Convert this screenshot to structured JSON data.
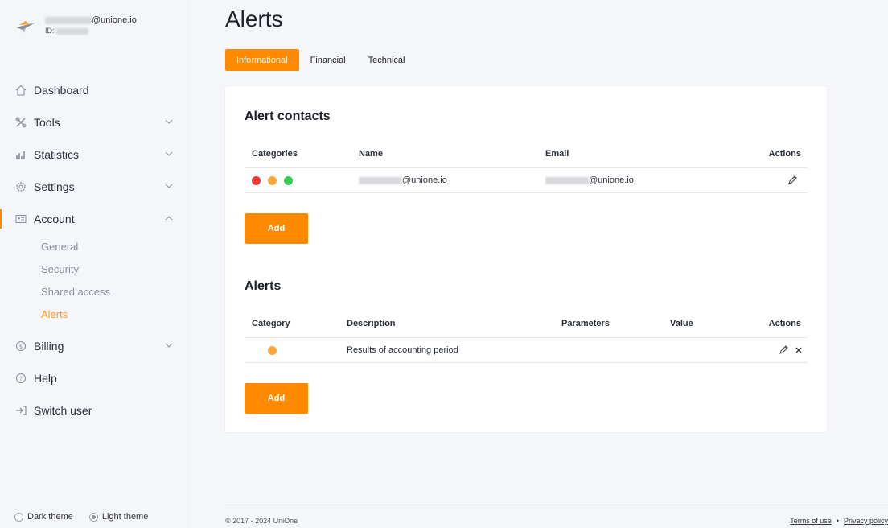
{
  "user": {
    "email_suffix": "@unione.io",
    "id_label": "ID:"
  },
  "nav": {
    "dashboard": "Dashboard",
    "tools": "Tools",
    "statistics": "Statistics",
    "settings": "Settings",
    "account": "Account",
    "account_sub": [
      "General",
      "Security",
      "Shared access",
      "Alerts"
    ],
    "billing": "Billing",
    "help": "Help",
    "switch_user": "Switch user"
  },
  "theme": {
    "dark": "Dark theme",
    "light": "Light theme",
    "selected": "light"
  },
  "page": {
    "title": "Alerts",
    "tabs": [
      "Informational",
      "Financial",
      "Technical"
    ],
    "active_tab": "Informational"
  },
  "contacts": {
    "title": "Alert contacts",
    "headers": [
      "Categories",
      "Name",
      "Email",
      "Actions"
    ],
    "rows": [
      {
        "name_suffix": "@unione.io",
        "email_suffix": "@unione.io",
        "categories": [
          "#ee3a36",
          "#ffa63a",
          "#35cf52"
        ]
      }
    ],
    "add_label": "Add"
  },
  "alerts": {
    "title": "Alerts",
    "headers": [
      "Category",
      "Description",
      "Parameters",
      "Value",
      "Actions"
    ],
    "rows": [
      {
        "category_color": "#ffa63a",
        "description": "Results of accounting period"
      }
    ],
    "add_label": "Add"
  },
  "footer": {
    "copyright": "© 2017 - 2024 UniOne",
    "terms": "Terms of use",
    "privacy": "Privacy policy"
  },
  "colors": {
    "accent": "#ff8a00"
  }
}
